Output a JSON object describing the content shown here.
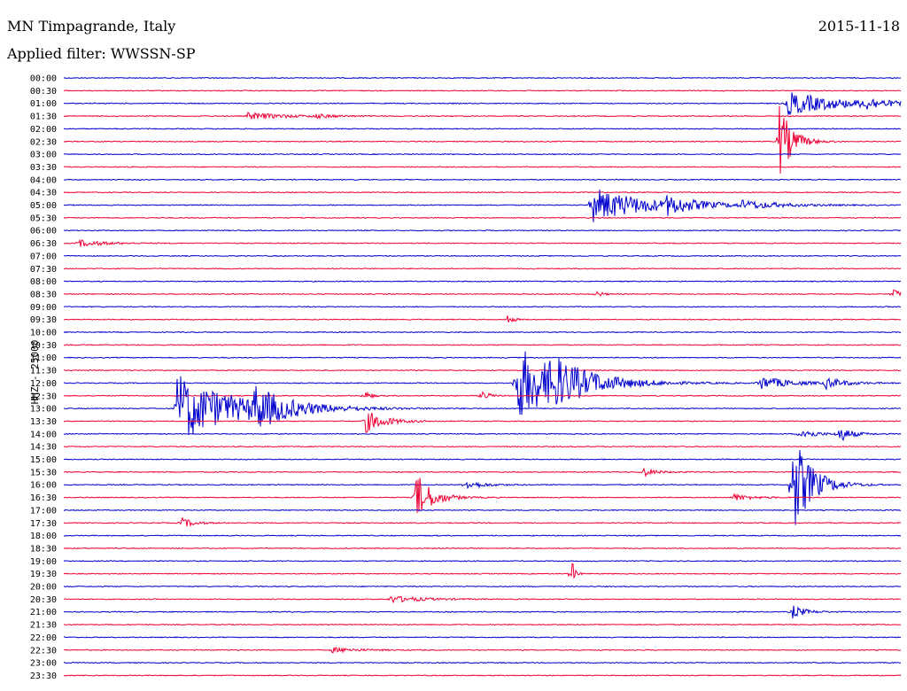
{
  "header": {
    "station": "MN Timpagrande, Italy",
    "date": "2015-11-18",
    "filter": "Applied filter: WWSSN-SP"
  },
  "chart_data": {
    "type": "line",
    "title": "MN Timpagrande, Italy",
    "ylabel": "HHZ - 25000",
    "row_labels": [
      "00:00",
      "00:30",
      "01:00",
      "01:30",
      "02:00",
      "02:30",
      "03:00",
      "03:30",
      "04:00",
      "04:30",
      "05:00",
      "05:30",
      "06:00",
      "06:30",
      "07:00",
      "07:30",
      "08:00",
      "08:30",
      "09:00",
      "09:30",
      "10:00",
      "10:30",
      "11:00",
      "11:30",
      "12:00",
      "12:30",
      "13:00",
      "13:30",
      "14:00",
      "14:30",
      "15:00",
      "15:30",
      "16:00",
      "16:30",
      "17:00",
      "17:30",
      "18:00",
      "18:30",
      "19:00",
      "19:30",
      "20:00",
      "20:30",
      "21:00",
      "21:30",
      "22:00",
      "22:30",
      "23:00",
      "23:30"
    ],
    "row_colors": [
      "#0000cc",
      "#ee0033"
    ],
    "series": [
      {
        "row": 2,
        "events": [
          {
            "t": 0.864,
            "amp": 14,
            "dur": 0.08
          },
          {
            "t": 0.955,
            "amp": 6,
            "dur": 0.03
          }
        ]
      },
      {
        "row": 3,
        "events": [
          {
            "t": 0.22,
            "amp": 4,
            "dur": 0.06
          },
          {
            "t": 0.3,
            "amp": 2,
            "dur": 0.03
          }
        ]
      },
      {
        "row": 5,
        "events": [
          {
            "t": 0.855,
            "amp": 42,
            "dur": 0.02
          }
        ]
      },
      {
        "row": 10,
        "events": [
          {
            "t": 0.63,
            "amp": 20,
            "dur": 0.09
          },
          {
            "t": 0.72,
            "amp": 8,
            "dur": 0.04
          },
          {
            "t": 0.81,
            "amp": 4,
            "dur": 0.06
          }
        ]
      },
      {
        "row": 13,
        "events": [
          {
            "t": 0.018,
            "amp": 4,
            "dur": 0.04
          }
        ]
      },
      {
        "row": 17,
        "events": [
          {
            "t": 0.636,
            "amp": 4,
            "dur": 0.01
          },
          {
            "t": 0.99,
            "amp": 5,
            "dur": 0.02
          }
        ]
      },
      {
        "row": 19,
        "events": [
          {
            "t": 0.53,
            "amp": 5,
            "dur": 0.01
          }
        ]
      },
      {
        "row": 24,
        "events": [
          {
            "t": 0.54,
            "amp": 45,
            "dur": 0.07
          },
          {
            "t": 0.58,
            "amp": 16,
            "dur": 0.06
          },
          {
            "t": 0.83,
            "amp": 8,
            "dur": 0.05
          },
          {
            "t": 0.91,
            "amp": 6,
            "dur": 0.03
          }
        ]
      },
      {
        "row": 25,
        "events": [
          {
            "t": 0.359,
            "amp": 6,
            "dur": 0.01
          },
          {
            "t": 0.5,
            "amp": 7,
            "dur": 0.01
          }
        ]
      },
      {
        "row": 26,
        "events": [
          {
            "t": 0.135,
            "amp": 40,
            "dur": 0.09
          },
          {
            "t": 0.225,
            "amp": 20,
            "dur": 0.05
          }
        ]
      },
      {
        "row": 27,
        "events": [
          {
            "t": 0.359,
            "amp": 14,
            "dur": 0.03
          }
        ]
      },
      {
        "row": 28,
        "events": [
          {
            "t": 0.88,
            "amp": 8,
            "dur": 0.02
          },
          {
            "t": 0.925,
            "amp": 10,
            "dur": 0.02
          }
        ]
      },
      {
        "row": 31,
        "events": [
          {
            "t": 0.69,
            "amp": 6,
            "dur": 0.02
          }
        ]
      },
      {
        "row": 32,
        "events": [
          {
            "t": 0.48,
            "amp": 5,
            "dur": 0.03
          },
          {
            "t": 0.87,
            "amp": 60,
            "dur": 0.03
          }
        ]
      },
      {
        "row": 33,
        "events": [
          {
            "t": 0.42,
            "amp": 30,
            "dur": 0.025
          },
          {
            "t": 0.8,
            "amp": 4,
            "dur": 0.03
          }
        ]
      },
      {
        "row": 35,
        "events": [
          {
            "t": 0.14,
            "amp": 6,
            "dur": 0.02
          }
        ]
      },
      {
        "row": 39,
        "events": [
          {
            "t": 0.607,
            "amp": 16,
            "dur": 0.005
          }
        ]
      },
      {
        "row": 41,
        "events": [
          {
            "t": 0.39,
            "amp": 4,
            "dur": 0.05
          }
        ]
      },
      {
        "row": 42,
        "events": [
          {
            "t": 0.87,
            "amp": 8,
            "dur": 0.02
          }
        ]
      },
      {
        "row": 45,
        "events": [
          {
            "t": 0.32,
            "amp": 3,
            "dur": 0.04
          }
        ]
      }
    ]
  }
}
